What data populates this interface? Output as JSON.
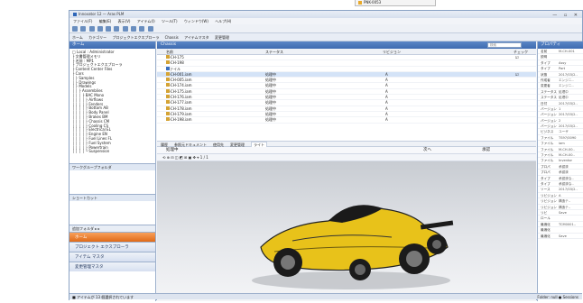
{
  "popup": {
    "label": "PNK-0053"
  },
  "app": {
    "title": "Innovator 12 — Aras PLM",
    "menu": [
      "ファイル(F)",
      "編集(E)",
      "表示(V)",
      "アイテム(I)",
      "ツール(T)",
      "ウィンドウ(W)",
      "ヘルプ(H)"
    ],
    "toolbar2": [
      "ホーム",
      "カテゴリー",
      "プロジェクトエクスプローラ",
      "Chassis",
      "アイテムマスタ",
      "変更管理"
    ],
    "window_controls": "— ▫ ✕"
  },
  "left": {
    "header": "ホーム",
    "tree": [
      "□ Local : Administrator",
      "  ├ 文書管理メモリ",
      "  ├ 名前 : MP1",
      "  ├ プロジェクトエクスプローラ",
      "  ├ Content Center Files",
      "  ├ Cars",
      "  │ ├ Samples",
      "  │ ├ Drawings",
      "  │ ├ Models",
      "  │ │ ├ Assemblies",
      "  │ │ │ ├ BAC Mono",
      "  │ │ │ │ ├ Airflows",
      "  │ │ │ │ ├ Fenders",
      "  │ │ │ │ ├ Bottom AB",
      "  │ │ │ │ ├ Body Panel",
      "  │ │ │ │ ├ Brakes BM",
      "  │ │ │ │ ├ Chassis CM",
      "  │ │ │ │ ├ Cooling CS",
      "  │ │ │ │ ├ Electrical EL",
      "  │ │ │ │ ├ Engine EN",
      "  │ │ │ │ ├ Fuel Lines FL",
      "  │ │ │ │ ├ Fuel System",
      "  │ │ │ │ ├ Powertrain",
      "  │ │ │ │ └ Suspension"
    ],
    "sub_panel_1": "ワークグループフォルダ",
    "sub_panel_2": "ショートカット",
    "chevrons": "追加フォルダ  ▸  ▸",
    "nav": [
      {
        "label": "ホーム",
        "active": true
      },
      {
        "label": "プロジェクト エクスプローラ",
        "active": false
      },
      {
        "label": "アイテム マスタ",
        "active": false
      },
      {
        "label": "変更管理マスタ",
        "active": false
      }
    ]
  },
  "main": {
    "header": "Chassis",
    "search_placeholder": "検索",
    "columns": [
      "名前",
      "ステータス",
      "リビジョン",
      "チェック"
    ],
    "rows": [
      {
        "name": "M-CH-175",
        "status": "",
        "rev": "",
        "chk": "☑",
        "folder": false,
        "sel": false
      },
      {
        "name": "M-CH-198",
        "status": "",
        "rev": "",
        "chk": "",
        "folder": false,
        "sel": false
      },
      {
        "name": "ファイル",
        "status": "",
        "rev": "",
        "chk": "",
        "folder": true,
        "sel": false
      },
      {
        "name": "M-CH-001.iam",
        "status": "処理中",
        "rev": "A",
        "chk": "☑",
        "folder": false,
        "sel": true
      },
      {
        "name": "M-CH-005.iam",
        "status": "処理中",
        "rev": "A",
        "chk": "",
        "folder": false,
        "sel": false
      },
      {
        "name": "M-CH-174.iam",
        "status": "処理中",
        "rev": "A",
        "chk": "",
        "folder": false,
        "sel": false
      },
      {
        "name": "M-CH-175.iam",
        "status": "処理中",
        "rev": "A",
        "chk": "",
        "folder": false,
        "sel": false
      },
      {
        "name": "M-CH-176.iam",
        "status": "処理中",
        "rev": "A",
        "chk": "",
        "folder": false,
        "sel": false
      },
      {
        "name": "M-CH-177.iam",
        "status": "処理中",
        "rev": "A",
        "chk": "",
        "folder": false,
        "sel": false
      },
      {
        "name": "M-CH-178.iam",
        "status": "処理中",
        "rev": "A",
        "chk": "",
        "folder": false,
        "sel": false
      },
      {
        "name": "M-CH-179.iam",
        "status": "処理中",
        "rev": "A",
        "chk": "",
        "folder": false,
        "sel": false
      },
      {
        "name": "M-CH-198.iam",
        "status": "処理中",
        "rev": "A",
        "chk": "",
        "folder": false,
        "sel": false
      }
    ],
    "tabs": [
      "履歴",
      "参照元ドキュメント",
      "使用先",
      "変更管理",
      "ライト"
    ],
    "active_tab": "ライト",
    "field_label": "処理中",
    "field_next": "次へ",
    "field_status": "承認",
    "viewer_tools": "⟲ ⊕ ⊟ ◫ ◩ ⊞ ▣ ✥ ⌖  1 / 1",
    "car_color": "#e8c21a"
  },
  "right": {
    "header": "プロパティ",
    "props": [
      [
        "名前",
        "M-CH-001"
      ],
      [
        "説明",
        ""
      ],
      [
        "タイプ",
        "Assy"
      ],
      [
        "タイプ",
        "Part"
      ],
      [
        "状態",
        "2017/03/2.."
      ],
      [
        "作成者",
        "エンジニ.."
      ],
      [
        "変更者",
        "エンジニ.."
      ],
      [
        "ステータス",
        "処理中"
      ],
      [
        "ステータス",
        "処理中"
      ],
      [
        "日付",
        "2017/03/2.."
      ],
      [
        "バージョン",
        "1"
      ],
      [
        "バージョン",
        "2017/03/2.."
      ],
      [
        "バージョン",
        "2"
      ],
      [
        "バージョン",
        "2017/03/2.."
      ],
      [
        "ビジネス",
        "ユーザ"
      ],
      [
        "ファイル",
        "TS97/0090"
      ],
      [
        "ファイル",
        "iam"
      ],
      [
        "ファイル",
        "M-CH-00.."
      ],
      [
        "ファイル",
        "M-CH-00.."
      ],
      [
        "ファイル",
        "Inventor"
      ],
      [
        "プロパ",
        "承認済"
      ],
      [
        "プロパ",
        "承認済"
      ],
      [
        "タイプ",
        "承認済な.."
      ],
      [
        "タイプ",
        "承認済な.."
      ],
      [
        "ソース",
        "2017/03/2.."
      ],
      [
        "リビジョン",
        "A"
      ],
      [
        "リビジョン",
        "構造テ.."
      ],
      [
        "リビジョン",
        "構造テ.."
      ],
      [
        "リビ",
        "Save"
      ],
      [
        "ロール",
        ""
      ],
      [
        "最適化",
        "TCM0001.."
      ],
      [
        "最適化",
        ""
      ],
      [
        "最適化",
        "Save"
      ]
    ]
  },
  "status": {
    "left": "■ アイテムが 13 個選択されています",
    "right": "Folder: null  ● Sessions"
  }
}
